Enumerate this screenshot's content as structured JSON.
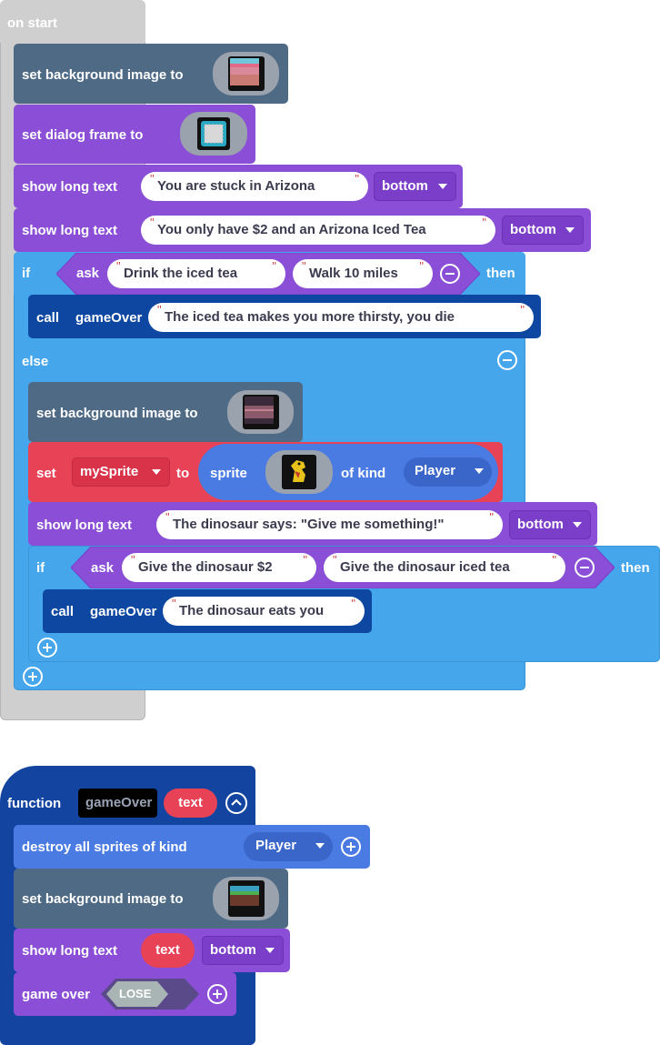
{
  "colors": {
    "event": "#cfcfcf",
    "scene": "#4f6a85",
    "text": "#8a4fd6",
    "logic": "#45a6eb",
    "call": "#0d47a1",
    "sprite": "#e84256",
    "spriteInner": "#4a7be3",
    "function": "#1244a0"
  },
  "on_start": {
    "label": "on start",
    "set_bg_1": {
      "label": "set background image to",
      "image": "desert-scene-image"
    },
    "set_dialog": {
      "label": "set dialog frame to",
      "image": "dialog-frame-image"
    },
    "show_text_1": {
      "label": "show long text",
      "text": "You are stuck in Arizona",
      "position": "bottom"
    },
    "show_text_2": {
      "label": "show long text",
      "text": "You only have $2 and an Arizona Iced Tea",
      "position": "bottom"
    },
    "if_1": {
      "if_label": "if",
      "ask_label": "ask",
      "option_a": "Drink the iced tea",
      "option_b": "Walk 10 miles",
      "then_label": "then",
      "call": {
        "label": "call",
        "function": "gameOver",
        "text": "The iced tea makes you more thirsty, you die"
      },
      "else_label": "else"
    },
    "set_bg_2": {
      "label": "set background image to",
      "image": "dark-scene-image"
    },
    "set_sprite": {
      "set_label": "set",
      "variable": "mySprite",
      "to_label": "to",
      "sprite_label": "sprite",
      "image": "dinosaur-image",
      "of_kind_label": "of kind",
      "kind": "Player"
    },
    "show_text_3": {
      "label": "show long text",
      "text": "The dinosaur says: \"Give me something!\"",
      "position": "bottom"
    },
    "if_2": {
      "if_label": "if",
      "ask_label": "ask",
      "option_a": "Give the dinosaur $2",
      "option_b": "Give the dinosaur iced tea",
      "then_label": "then",
      "call": {
        "label": "call",
        "function": "gameOver",
        "text": "The dinosaur eats you"
      }
    }
  },
  "function_block": {
    "label": "function",
    "name": "gameOver",
    "param": "text",
    "destroy": {
      "label": "destroy all sprites of kind",
      "kind": "Player"
    },
    "set_bg": {
      "label": "set background image to",
      "image": "game-over-scene-image"
    },
    "show_text": {
      "label": "show long text",
      "param": "text",
      "position": "bottom"
    },
    "game_over": {
      "label": "game over",
      "result": "LOSE"
    }
  }
}
